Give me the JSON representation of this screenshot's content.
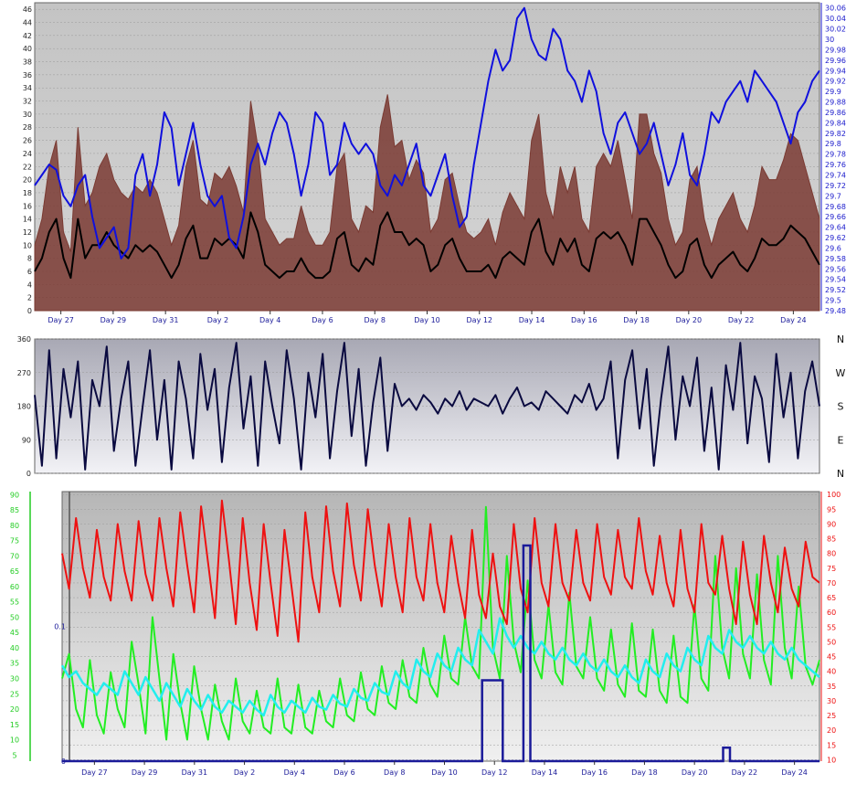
{
  "chart_data": [
    {
      "type": "line",
      "panel": "top",
      "colors": {
        "left_axis": "#222222",
        "right_axis": "#1a1acc",
        "gust": "#7a3a32",
        "wind": "#000000",
        "pressure": "#1010dd"
      },
      "x_tick_labels": [
        "Day 27",
        "Day 29",
        "Day 31",
        "Day 2",
        "Day 4",
        "Day 6",
        "Day 8",
        "Day 10",
        "Day 12",
        "Day 14",
        "Day 16",
        "Day 18",
        "Day 20",
        "Day 22",
        "Day 24"
      ],
      "y_left_ticks": [
        "0",
        "2",
        "4",
        "6",
        "8",
        "10",
        "12",
        "14",
        "16",
        "18",
        "20",
        "22",
        "24",
        "26",
        "28",
        "30",
        "32",
        "34",
        "36",
        "38",
        "40",
        "42",
        "44",
        "46"
      ],
      "y_right_ticks": [
        "29.48",
        "29.5",
        "29.52",
        "29.54",
        "29.56",
        "29.58",
        "29.6",
        "29.62",
        "29.64",
        "29.66",
        "29.68",
        "29.7",
        "29.72",
        "29.74",
        "29.76",
        "29.78",
        "29.8",
        "29.82",
        "29.84",
        "29.86",
        "29.88",
        "29.9",
        "29.92",
        "29.94",
        "29.96",
        "29.98",
        "30",
        "30.02",
        "30.04",
        "30.06"
      ],
      "ylim_left": [
        0,
        47
      ],
      "ylim_right": [
        29.48,
        30.07
      ],
      "grid": true,
      "series": [
        {
          "key": "gust",
          "series_type": "area",
          "values": [
            10,
            14,
            22,
            26,
            12,
            9,
            28,
            16,
            18,
            22,
            24,
            20,
            18,
            17,
            19,
            18,
            20,
            18,
            14,
            10,
            13,
            22,
            26,
            17,
            16,
            21,
            20,
            22,
            19,
            15,
            32,
            25,
            14,
            12,
            10,
            11,
            11,
            16,
            12,
            10,
            10,
            12,
            22,
            24,
            14,
            12,
            16,
            15,
            28,
            33,
            25,
            26,
            20,
            23,
            21,
            12,
            14,
            20,
            21,
            16,
            12,
            11,
            12,
            14,
            10,
            15,
            18,
            16,
            14,
            26,
            30,
            18,
            14,
            22,
            18,
            22,
            14,
            12,
            22,
            24,
            22,
            26,
            20,
            14,
            30,
            30,
            24,
            21,
            14,
            10,
            12,
            20,
            22,
            14,
            10,
            14,
            16,
            18,
            14,
            12,
            16,
            22,
            20,
            20,
            23,
            27,
            26,
            22,
            18,
            14
          ]
        },
        {
          "key": "wind",
          "series_type": "line",
          "values": [
            6,
            8,
            12,
            14,
            8,
            5,
            14,
            8,
            10,
            10,
            12,
            10,
            9,
            8,
            10,
            9,
            10,
            9,
            7,
            5,
            7,
            11,
            13,
            8,
            8,
            11,
            10,
            11,
            10,
            8,
            15,
            12,
            7,
            6,
            5,
            6,
            6,
            8,
            6,
            5,
            5,
            6,
            11,
            12,
            7,
            6,
            8,
            7,
            13,
            15,
            12,
            12,
            10,
            11,
            10,
            6,
            7,
            10,
            11,
            8,
            6,
            6,
            6,
            7,
            5,
            8,
            9,
            8,
            7,
            12,
            14,
            9,
            7,
            11,
            9,
            11,
            7,
            6,
            11,
            12,
            11,
            12,
            10,
            7,
            14,
            14,
            12,
            10,
            7,
            5,
            6,
            10,
            11,
            7,
            5,
            7,
            8,
            9,
            7,
            6,
            8,
            11,
            10,
            10,
            11,
            13,
            12,
            11,
            9,
            7
          ]
        },
        {
          "key": "pressure",
          "series_type": "line",
          "values": [
            29.72,
            29.74,
            29.76,
            29.75,
            29.7,
            29.68,
            29.72,
            29.74,
            29.66,
            29.6,
            29.62,
            29.64,
            29.58,
            29.6,
            29.74,
            29.78,
            29.7,
            29.76,
            29.86,
            29.83,
            29.72,
            29.78,
            29.84,
            29.76,
            29.7,
            29.68,
            29.7,
            29.62,
            29.6,
            29.66,
            29.76,
            29.8,
            29.76,
            29.82,
            29.86,
            29.84,
            29.78,
            29.7,
            29.76,
            29.86,
            29.84,
            29.74,
            29.76,
            29.84,
            29.8,
            29.78,
            29.8,
            29.78,
            29.72,
            29.7,
            29.74,
            29.72,
            29.76,
            29.8,
            29.72,
            29.7,
            29.74,
            29.78,
            29.7,
            29.64,
            29.66,
            29.76,
            29.84,
            29.92,
            29.98,
            29.94,
            29.96,
            30.04,
            30.06,
            30.0,
            29.97,
            29.96,
            30.02,
            30.0,
            29.94,
            29.92,
            29.88,
            29.94,
            29.9,
            29.82,
            29.78,
            29.84,
            29.86,
            29.82,
            29.78,
            29.8,
            29.84,
            29.78,
            29.72,
            29.76,
            29.82,
            29.74,
            29.72,
            29.78,
            29.86,
            29.84,
            29.88,
            29.9,
            29.92,
            29.88,
            29.94,
            29.92,
            29.9,
            29.88,
            29.84,
            29.8,
            29.86,
            29.88,
            29.92,
            29.94
          ]
        }
      ]
    },
    {
      "type": "line",
      "panel": "middle",
      "colors": {
        "direction": "#0a0a40"
      },
      "y_left_ticks": [
        "0",
        "90",
        "180",
        "270",
        "360"
      ],
      "y_right_labels": [
        "N",
        "E",
        "S",
        "W",
        "N"
      ],
      "ylim": [
        0,
        360
      ],
      "grid": true,
      "series": [
        {
          "key": "direction",
          "values": [
            210,
            20,
            330,
            40,
            280,
            150,
            300,
            10,
            250,
            180,
            340,
            60,
            200,
            300,
            20,
            180,
            330,
            90,
            250,
            10,
            300,
            200,
            40,
            320,
            170,
            280,
            30,
            230,
            350,
            120,
            260,
            20,
            300,
            180,
            80,
            330,
            200,
            10,
            270,
            150,
            320,
            40,
            220,
            350,
            100,
            280,
            20,
            190,
            310,
            60,
            240,
            180,
            200,
            170,
            210,
            190,
            160,
            200,
            180,
            220,
            170,
            200,
            190,
            180,
            210,
            160,
            200,
            230,
            180,
            190,
            170,
            220,
            200,
            180,
            160,
            210,
            190,
            240,
            170,
            200,
            300,
            40,
            250,
            330,
            120,
            280,
            20,
            200,
            340,
            90,
            260,
            180,
            310,
            60,
            230,
            10,
            290,
            170,
            350,
            80,
            260,
            200,
            30,
            320,
            150,
            270,
            40,
            220,
            300,
            180
          ]
        }
      ]
    },
    {
      "type": "line",
      "panel": "bottom",
      "colors": {
        "left_axis": "#22cc22",
        "right_axis": "#ee1111",
        "inner_axis": "#1a1a99",
        "temp": "#ee1111",
        "humidity": "#22ee22",
        "dewpoint": "#22eeee",
        "rain": "#1a1a99"
      },
      "x_tick_labels": [
        "Day 27",
        "Day 29",
        "Day 31",
        "Day 2",
        "Day 4",
        "Day 6",
        "Day 8",
        "Day 10",
        "Day 12",
        "Day 14",
        "Day 16",
        "Day 18",
        "Day 20",
        "Day 22",
        "Day 24"
      ],
      "y_left_ticks": [
        "5",
        "10",
        "15",
        "20",
        "25",
        "30",
        "35",
        "40",
        "45",
        "50",
        "55",
        "60",
        "65",
        "70",
        "75",
        "80",
        "85",
        "90"
      ],
      "y_right_ticks": [
        "10",
        "15",
        "20",
        "25",
        "30",
        "35",
        "40",
        "45",
        "50",
        "55",
        "60",
        "65",
        "70",
        "75",
        "80",
        "85",
        "90",
        "95",
        "100"
      ],
      "y_inner_ticks": [
        "0",
        "0.1"
      ],
      "ylim_left": [
        3,
        91
      ],
      "ylim_right": [
        9.5,
        101
      ],
      "ylim_inner": [
        0,
        0.2
      ],
      "grid": true,
      "series": [
        {
          "key": "temp",
          "values": [
            80,
            68,
            92,
            75,
            65,
            88,
            72,
            64,
            90,
            74,
            64,
            91,
            73,
            64,
            92,
            75,
            62,
            94,
            76,
            60,
            96,
            77,
            58,
            98,
            78,
            56,
            92,
            70,
            54,
            90,
            70,
            52,
            88,
            69,
            50,
            94,
            72,
            60,
            96,
            74,
            62,
            97,
            76,
            64,
            95,
            76,
            62,
            90,
            72,
            60,
            92,
            72,
            64,
            90,
            70,
            60,
            86,
            70,
            58,
            88,
            66,
            58,
            80,
            62,
            56,
            90,
            68,
            60,
            92,
            70,
            62,
            90,
            70,
            64,
            88,
            70,
            64,
            90,
            72,
            66,
            88,
            72,
            68,
            92,
            74,
            66,
            86,
            70,
            62,
            88,
            68,
            60,
            90,
            70,
            66,
            86,
            68,
            56,
            84,
            66,
            56,
            86,
            70,
            60,
            82,
            68,
            62,
            84,
            72,
            70
          ]
        },
        {
          "key": "humidity",
          "values": [
            30,
            38,
            20,
            14,
            36,
            18,
            12,
            32,
            20,
            14,
            42,
            28,
            12,
            50,
            30,
            10,
            38,
            22,
            10,
            34,
            20,
            10,
            28,
            16,
            10,
            30,
            16,
            12,
            26,
            14,
            12,
            30,
            14,
            12,
            28,
            14,
            12,
            26,
            16,
            14,
            30,
            18,
            16,
            32,
            20,
            18,
            34,
            22,
            20,
            36,
            24,
            22,
            40,
            28,
            24,
            44,
            30,
            28,
            50,
            34,
            30,
            86,
            40,
            30,
            70,
            42,
            32,
            62,
            36,
            30,
            54,
            32,
            28,
            58,
            34,
            30,
            50,
            30,
            26,
            46,
            28,
            24,
            48,
            26,
            24,
            46,
            26,
            22,
            44,
            24,
            22,
            54,
            30,
            26,
            70,
            40,
            30,
            66,
            38,
            30,
            64,
            36,
            28,
            70,
            40,
            30,
            60,
            34,
            28,
            36
          ]
        },
        {
          "key": "dewpoint",
          "values": [
            42,
            38,
            40,
            36,
            34,
            32,
            36,
            34,
            32,
            40,
            36,
            32,
            38,
            34,
            30,
            36,
            32,
            28,
            34,
            30,
            27,
            32,
            28,
            26,
            30,
            28,
            26,
            30,
            27,
            25,
            32,
            28,
            26,
            30,
            28,
            26,
            31,
            28,
            27,
            32,
            29,
            28,
            34,
            31,
            30,
            36,
            33,
            32,
            40,
            36,
            34,
            44,
            40,
            38,
            46,
            42,
            40,
            48,
            44,
            42,
            54,
            50,
            46,
            58,
            52,
            48,
            52,
            48,
            46,
            50,
            46,
            44,
            48,
            44,
            42,
            46,
            42,
            40,
            44,
            40,
            38,
            42,
            38,
            36,
            44,
            40,
            38,
            46,
            42,
            40,
            48,
            44,
            42,
            52,
            48,
            46,
            54,
            50,
            48,
            52,
            48,
            46,
            50,
            46,
            44,
            48,
            44,
            42,
            40,
            38
          ]
        },
        {
          "key": "rain",
          "values": [
            0,
            0,
            0,
            0,
            0,
            0,
            0,
            0,
            0,
            0,
            0,
            0,
            0,
            0,
            0,
            0,
            0,
            0,
            0,
            0,
            0,
            0,
            0,
            0,
            0,
            0,
            0,
            0,
            0,
            0,
            0,
            0,
            0,
            0,
            0,
            0,
            0,
            0,
            0,
            0,
            0,
            0,
            0,
            0,
            0,
            0,
            0,
            0,
            0,
            0,
            0,
            0,
            0,
            0,
            0,
            0,
            0,
            0,
            0,
            0,
            0,
            0.06,
            0.06,
            0.06,
            0,
            0,
            0,
            0.16,
            0,
            0,
            0,
            0,
            0,
            0,
            0,
            0,
            0,
            0,
            0,
            0,
            0,
            0,
            0,
            0,
            0,
            0,
            0,
            0,
            0,
            0,
            0,
            0,
            0,
            0,
            0,
            0,
            0.01,
            0,
            0,
            0,
            0,
            0,
            0,
            0,
            0,
            0,
            0,
            0,
            0,
            0
          ]
        }
      ]
    }
  ]
}
